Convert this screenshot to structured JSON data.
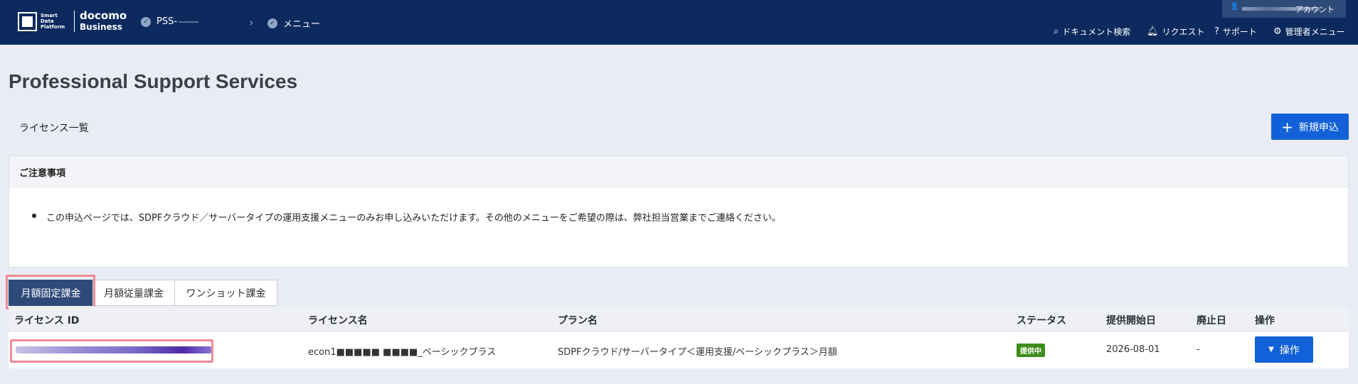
{
  "header": {
    "logo": {
      "sdp_line1": "Smart",
      "sdp_line2": "Data",
      "sdp_line3": "Platform",
      "brand_top": "docomo",
      "brand_bottom": "Business"
    },
    "breadcrumbs": [
      {
        "label": "PSS-"
      },
      {
        "label": "メニュー"
      }
    ],
    "account_label": "アカウント",
    "nav": [
      {
        "label": "ドキュメント検索",
        "icon": "search-icon"
      },
      {
        "label": "リクエスト",
        "icon": "bell-icon"
      },
      {
        "label": "サポート",
        "icon": "help-icon"
      },
      {
        "label": "管理者メニュー",
        "icon": "gear-icon"
      }
    ]
  },
  "page": {
    "title": "Professional Support Services",
    "list_title": "ライセンス一覧",
    "new_button": "新規申込"
  },
  "notice": {
    "heading": "ご注意事項",
    "text": "この申込ページでは、SDPFクラウド／サーバータイプの運用支援メニューのみお申し込みいただけます。その他のメニューをご希望の際は、弊社担当営業までご連絡ください。"
  },
  "tabs": [
    {
      "label": "月額固定課金",
      "active": true
    },
    {
      "label": "月額従量課金",
      "active": false
    },
    {
      "label": "ワンショット課金",
      "active": false
    }
  ],
  "table": {
    "columns": [
      "ライセンス ID",
      "ライセンス名",
      "プラン名",
      "ステータス",
      "提供開始日",
      "廃止日",
      "操作"
    ],
    "rows": [
      {
        "license_id": "",
        "license_name": "econ1■■■■■ ■■■■_ベーシックプラス",
        "plan_name": "SDPFクラウド/サーバータイプ＜運用支援/ベーシックプラス＞月額",
        "status": "提供中",
        "start_date": "2026-08-01",
        "end_date": "-",
        "action": "操作"
      }
    ]
  },
  "colors": {
    "header_bg": "#0c2a5e",
    "primary": "#1361d8",
    "tab_active": "#2e4a79",
    "status_green": "#3e8c1a",
    "highlight": "#f08a95"
  }
}
